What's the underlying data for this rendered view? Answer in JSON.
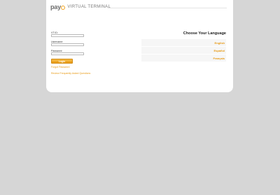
{
  "header": {
    "logo_text": "pay",
    "title": "VIRTUAL TERMINAL"
  },
  "login": {
    "vt_id_label": "VT ID:",
    "vt_id_value": "",
    "username_label": "Username:",
    "username_value": "",
    "password_label": "Password:",
    "password_value": "",
    "login_button": "Login"
  },
  "links": {
    "forgot_password": "Forgot Password",
    "faq": "Review Frequently Asked Questions"
  },
  "language": {
    "title": "Choose Your Language",
    "options": [
      "English",
      "Español",
      "Français"
    ]
  },
  "colors": {
    "accent": "#e89a14",
    "background": "#d6d6d6",
    "panel": "#ffffff"
  }
}
